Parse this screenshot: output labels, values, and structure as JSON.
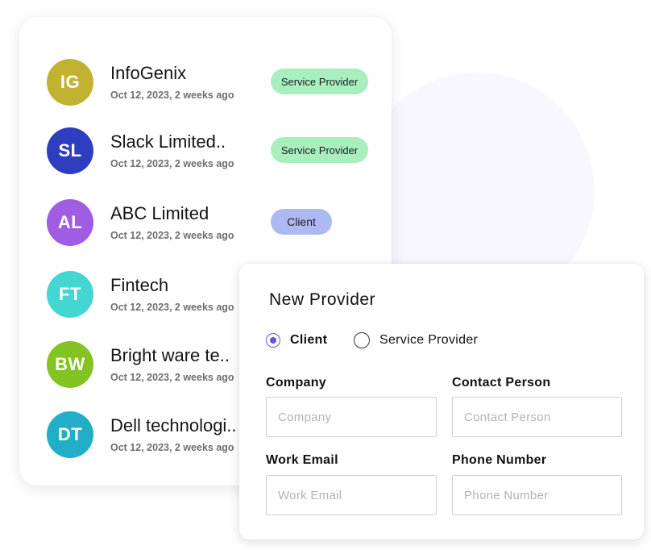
{
  "accounts": [
    {
      "initials": "IG",
      "name": "InfoGenix",
      "date": "Oct 12, 2023, 2 weeks ago",
      "badge": "Service Provider",
      "color": "#c2b232"
    },
    {
      "initials": "SL",
      "name": "Slack Limited..",
      "date": "Oct 12, 2023, 2 weeks ago",
      "badge": "Service Provider",
      "color": "#2f3ec0"
    },
    {
      "initials": "AL",
      "name": "ABC Limited",
      "date": "Oct 12, 2023, 2 weeks ago",
      "badge": "Client",
      "color": "#a15ce4"
    },
    {
      "initials": "FT",
      "name": "Fintech",
      "date": "Oct 12, 2023, 2 weeks ago",
      "color": "#43d6d3"
    },
    {
      "initials": "BW",
      "name": "Bright ware te..",
      "date": "Oct 12, 2023, 2 weeks ago",
      "color": "#83c423"
    },
    {
      "initials": "DT",
      "name": "Dell technologi..",
      "date": "Oct 12, 2023, 2 weeks ago",
      "color": "#22aec6"
    }
  ],
  "badge_colors": {
    "service_provider": "#a8efbd",
    "client": "#adb9f2"
  },
  "form": {
    "title": "New Provider",
    "radio": {
      "client": "Client",
      "service_provider": "Service Provider",
      "selected": "Client"
    },
    "accent": "#6b4ee6",
    "company": {
      "label": "Company",
      "placeholder": "Company"
    },
    "contact": {
      "label": "Contact Person",
      "placeholder": "Contact Person"
    },
    "email": {
      "label": "Work Email",
      "placeholder": "Work Email"
    },
    "phone": {
      "label": "Phone Number",
      "placeholder": "Phone Number"
    }
  }
}
